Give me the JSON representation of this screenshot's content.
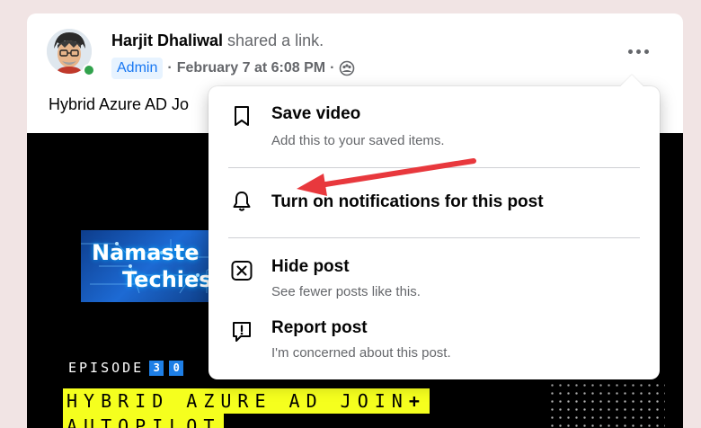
{
  "post": {
    "author_name": "Harjit Dhaliwal",
    "action_text": "shared a link.",
    "role_badge": "Admin",
    "date": "February 7 at 6:08 PM",
    "privacy_icon": "group-icon",
    "text_visible": "Hybrid Azure AD Jo"
  },
  "media": {
    "brand_line1": "Namaste",
    "brand_line2": "Techies",
    "episode_label": "EPISODE",
    "episode_digit1": "3",
    "episode_digit2": "0",
    "headline_line1": "HYBRID AZURE AD JOIN",
    "headline_plus": "+",
    "headline_line2": "AUTOPILOT"
  },
  "menu": {
    "items": [
      {
        "icon": "bookmark-icon",
        "title": "Save video",
        "subtitle": "Add this to your saved items."
      },
      {
        "icon": "bell-icon",
        "title": "Turn on notifications for this post",
        "subtitle": ""
      },
      {
        "icon": "hide-x-icon",
        "title": "Hide post",
        "subtitle": "See fewer posts like this."
      },
      {
        "icon": "report-icon",
        "title": "Report post",
        "subtitle": "I'm concerned about this post."
      }
    ]
  },
  "colors": {
    "page_bg": "#f1e4e4",
    "accent_blue": "#1877f2",
    "annotation_arrow": "#e8383d",
    "headline_highlight": "#f5ff1e",
    "online": "#31a24c"
  }
}
